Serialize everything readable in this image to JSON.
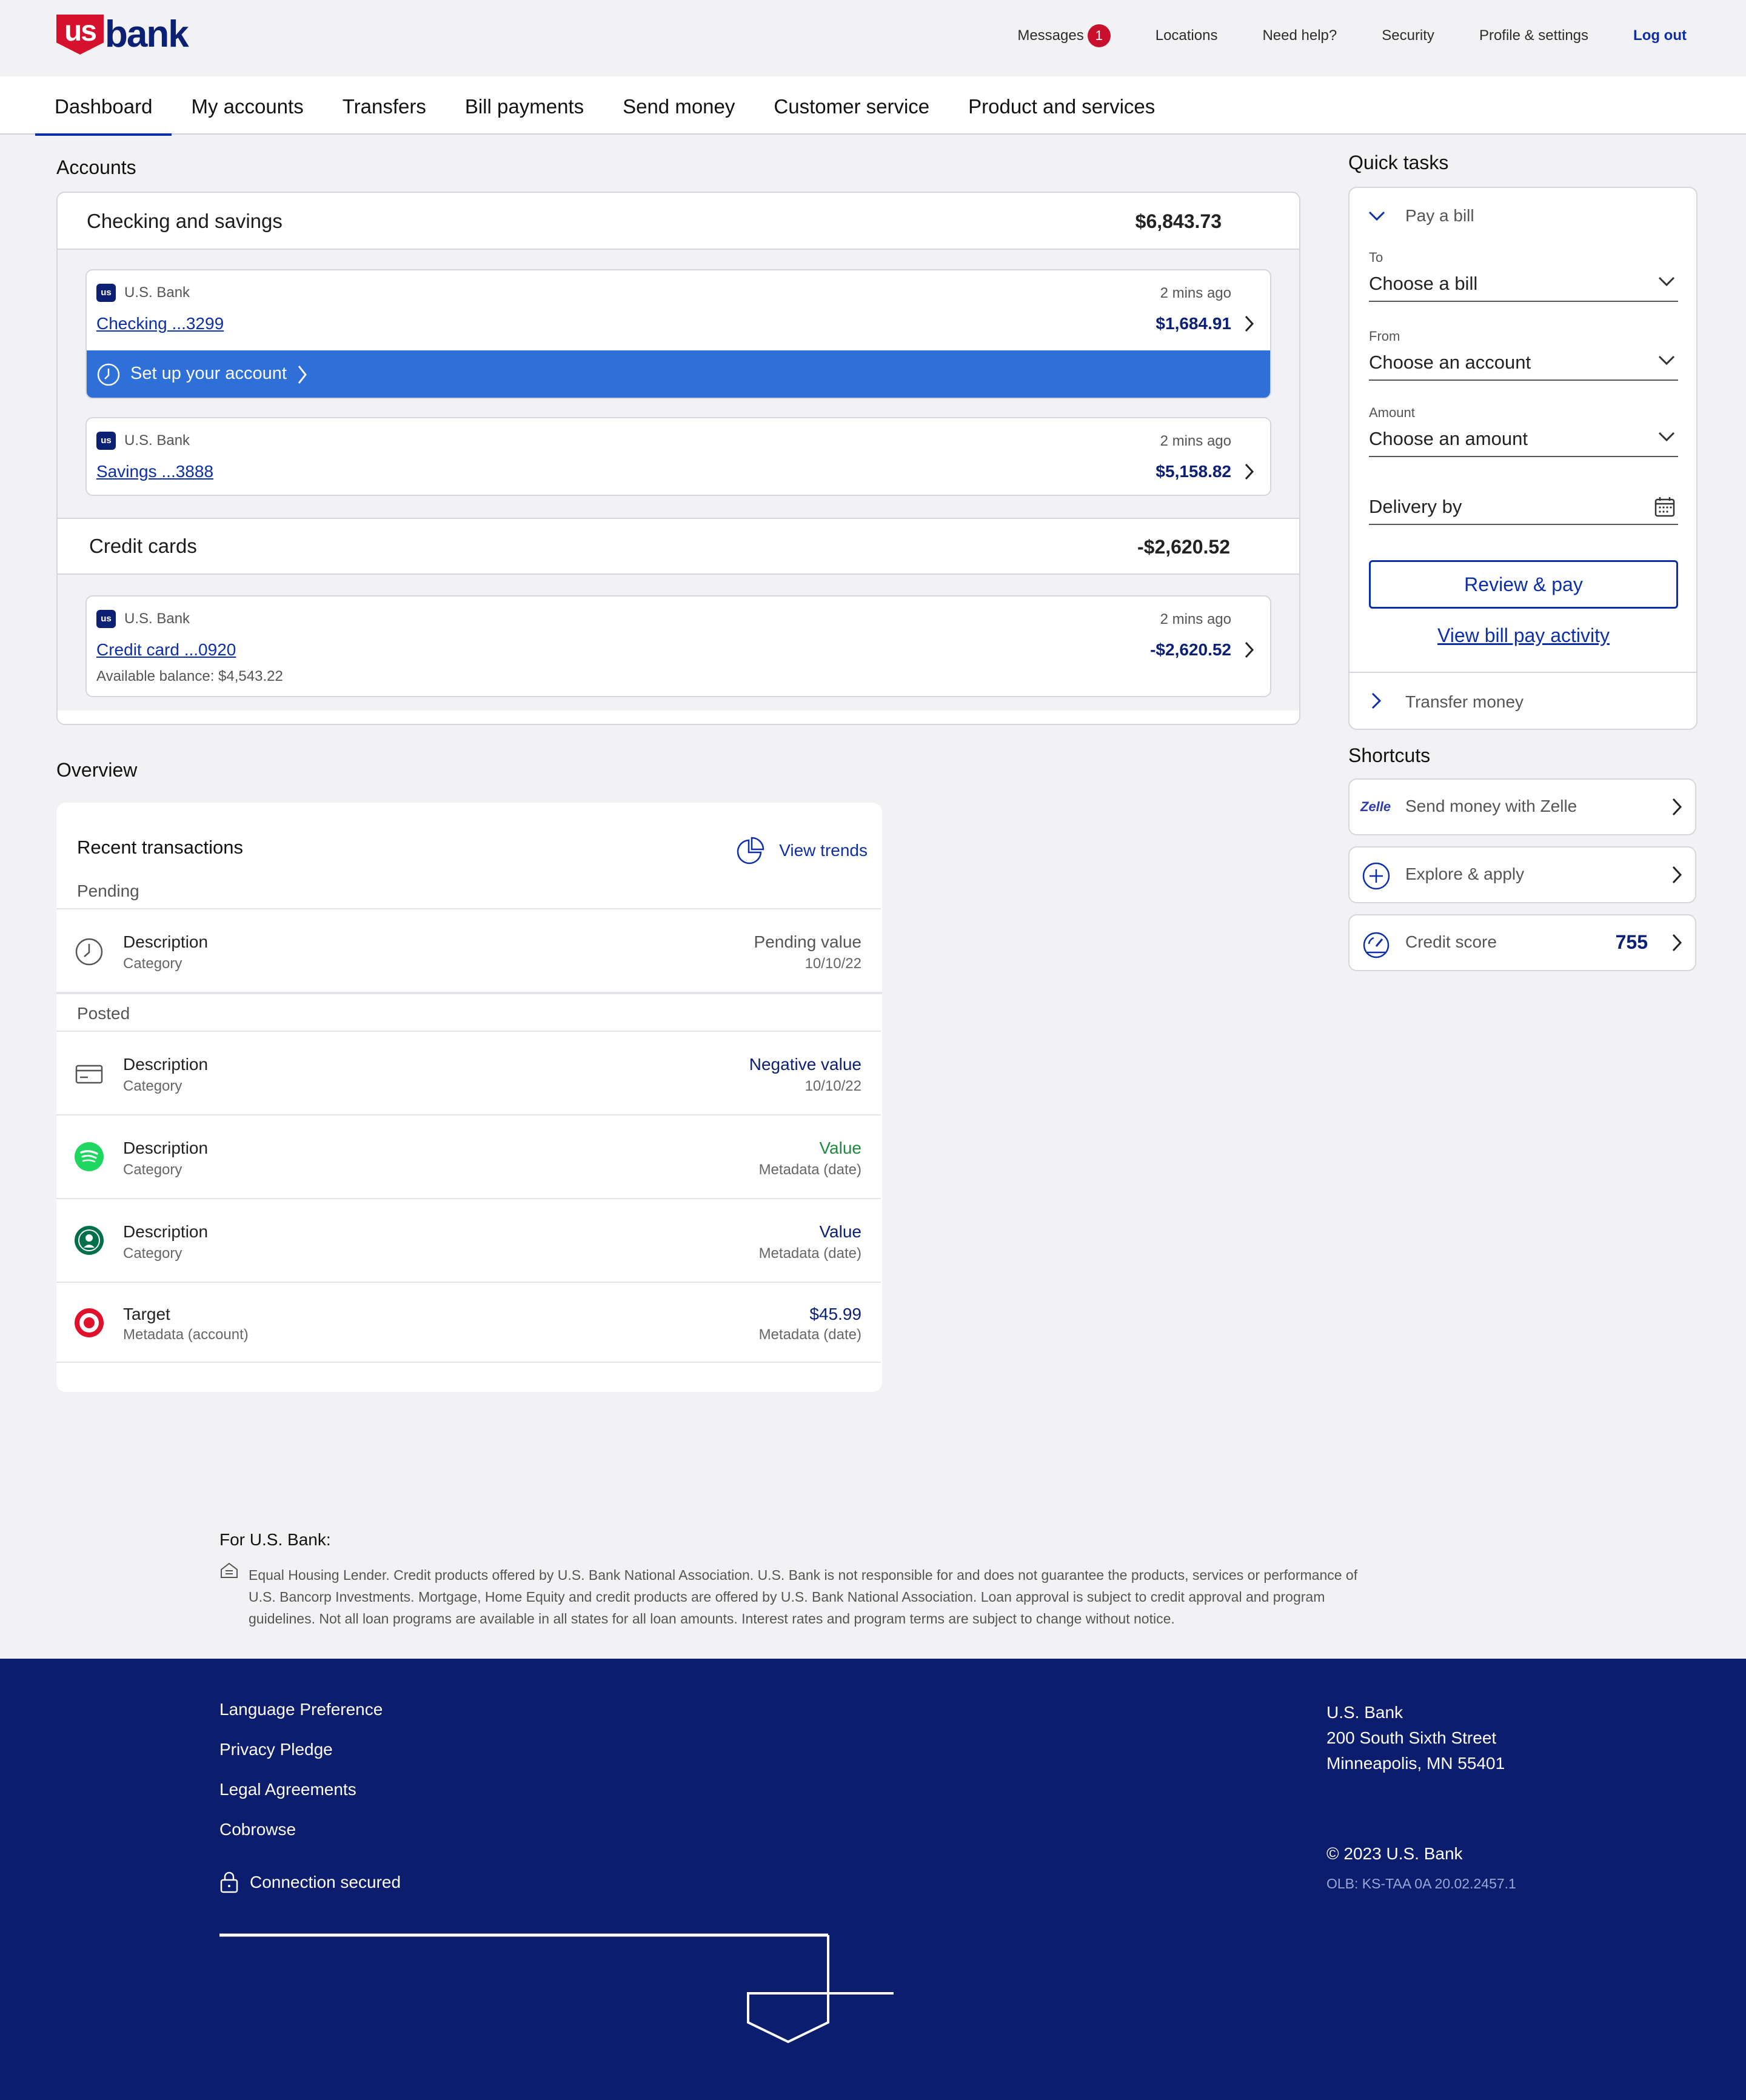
{
  "header": {
    "logo_shield": "us",
    "logo_word": "bank",
    "nav": [
      {
        "label": "Messages",
        "badge": "1"
      },
      {
        "label": "Locations"
      },
      {
        "label": "Need help?"
      },
      {
        "label": "Security"
      },
      {
        "label": "Profile & settings"
      }
    ],
    "logout": "Log out"
  },
  "main_nav": {
    "tabs": [
      "Dashboard",
      "My accounts",
      "Transfers",
      "Bill payments",
      "Send money",
      "Customer service",
      "Product and services"
    ],
    "active": "Dashboard"
  },
  "accounts": {
    "title": "Accounts",
    "checking_savings": {
      "label": "Checking and savings",
      "total": "$6,843.73",
      "items": [
        {
          "bank": "U.S. Bank",
          "name": "Checking ...3299",
          "balance": "$1,684.91",
          "updated": "2 mins ago",
          "setup": "Set up your account"
        },
        {
          "bank": "U.S. Bank",
          "name": "Savings ...3888",
          "balance": "$5,158.82",
          "updated": "2 mins ago"
        }
      ]
    },
    "credit_cards": {
      "label": "Credit cards",
      "total": "-$2,620.52",
      "items": [
        {
          "bank": "U.S. Bank",
          "name": "Credit card ...0920",
          "balance": "-$2,620.52",
          "updated": "2 mins ago",
          "available": "Available balance: $4,543.22"
        }
      ]
    }
  },
  "overview": {
    "title": "Overview",
    "recent_title": "Recent transactions",
    "view_trends": "View trends",
    "pending_label": "Pending",
    "posted_label": "Posted",
    "pending": [
      {
        "icon": "clock-icon",
        "desc": "Description",
        "cat": "Category",
        "value": "Pending value",
        "meta": "10/10/22"
      }
    ],
    "posted": [
      {
        "icon": "credit-card-icon",
        "desc": "Description",
        "cat": "Category",
        "value": "Negative value",
        "meta": "10/10/22"
      },
      {
        "icon": "spotify-icon",
        "desc": "Description",
        "cat": "Category",
        "value": "Value",
        "meta": "Metadata (date)"
      },
      {
        "icon": "starbucks-icon",
        "desc": "Description",
        "cat": "Category",
        "value": "Value",
        "meta": "Metadata (date)"
      },
      {
        "icon": "target-icon",
        "desc": "Target",
        "cat": "Metadata (account)",
        "value": "$45.99",
        "meta": "Metadata (date)"
      }
    ]
  },
  "quick_tasks": {
    "title": "Quick tasks",
    "pay_bill": "Pay a bill",
    "to_label": "To",
    "to_value": "Choose a bill",
    "from_label": "From",
    "from_value": "Choose an account",
    "amount_label": "Amount",
    "amount_value": "Choose an amount",
    "delivery_placeholder": "Delivery by",
    "review_button": "Review & pay",
    "activity_link": "View bill pay activity",
    "transfer": "Transfer money"
  },
  "shortcuts": {
    "title": "Shortcuts",
    "zelle_logo": "Zelle",
    "items": [
      {
        "label": "Send money with Zelle",
        "icon": "zelle-icon"
      },
      {
        "label": "Explore & apply",
        "icon": "plus-circle-icon"
      },
      {
        "label": "Credit score",
        "icon": "gauge-icon",
        "value": "755"
      }
    ]
  },
  "footer": {
    "disclosure_title": "For U.S. Bank:",
    "disclosure_lines": [
      "Equal Housing Lender. Credit products offered by U.S. Bank National Association. U.S. Bank is not responsible for and does not guarantee the products, services or performance of",
      "U.S. Bancorp Investments. Mortgage, Home Equity and credit products are offered by U.S. Bank National Association. Loan approval is subject to credit approval and program",
      "guidelines. Not all loan programs are available in all states for all loan amounts. Interest rates and program terms are subject to change without notice."
    ],
    "links": [
      "Language Preference",
      "Privacy Pledge",
      "Legal Agreements",
      "Cobrowse"
    ],
    "secure": "Connection secured",
    "address": [
      "U.S. Bank",
      "200 South Sixth Street",
      "Minneapolis, MN 55401"
    ],
    "copyright": "© 2023 U.S. Bank",
    "version": "OLB: KS-TAA 0A 20.02.2457.1"
  },
  "colors": {
    "brand_navy": "#0c2074",
    "brand_red": "#d5112d",
    "link_blue": "#0c2fa8",
    "setup_blue": "#2e6fd8",
    "positive_green": "#1e8a3c",
    "footer_bg": "#0c1d6e"
  }
}
